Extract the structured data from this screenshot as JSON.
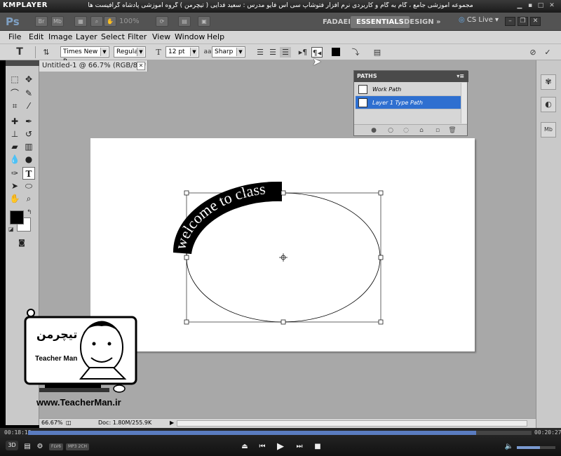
{
  "player": {
    "name": "KMPLAYER",
    "caption": "مجموعه آموزشی جامع ، گام به گام و کاربردی نرم افزار فتوشاپ سی اس فایو  مدرس : سعید فدایی ( تیچرمن ) گروه آموزشی پادشاه گرافیست ها",
    "time_elapsed": "00:18:13",
    "time_total": "00:20:27",
    "progress": 0.89,
    "volume": 0.6,
    "badges": [
      "FLV6",
      "MP3 2CH"
    ],
    "three_d": "3D"
  },
  "appbar": {
    "logo": "Ps",
    "zoom": "100%",
    "workspaces": [
      "FADAEI",
      "ESSENTIALS",
      "DESIGN"
    ],
    "active_workspace": "ESSENTIALS",
    "more": "»",
    "cs_live": "CS Live"
  },
  "menu": [
    "File",
    "Edit",
    "Image",
    "Layer",
    "Select",
    "Filter",
    "View",
    "Window",
    "Help"
  ],
  "options": {
    "font_family": "Times New R...",
    "font_style": "Regular",
    "font_size": "12 pt",
    "antialias": "Sharp",
    "size_icon": "T",
    "aa_icon": "aa"
  },
  "document": {
    "tab_title": "Untitled-1 @ 66.7% (RGB/8) *",
    "curved_text": "welcome to class",
    "colors": {
      "canvas": "#ffffff",
      "workspace": "#a8a8a8",
      "text_band": "#000000"
    }
  },
  "paths_panel": {
    "title": "PATHS",
    "items": [
      {
        "label": "Work Path",
        "selected": false
      },
      {
        "label": "Layer 1 Type Path",
        "selected": true
      }
    ]
  },
  "status": {
    "zoom": "66.67%",
    "doc_info": "Doc: 1.80M/255.9K"
  },
  "watermark": {
    "url": "www.TeacherMan.ir",
    "name": "Teacher Man",
    "logo_text": "تیچرمن"
  }
}
